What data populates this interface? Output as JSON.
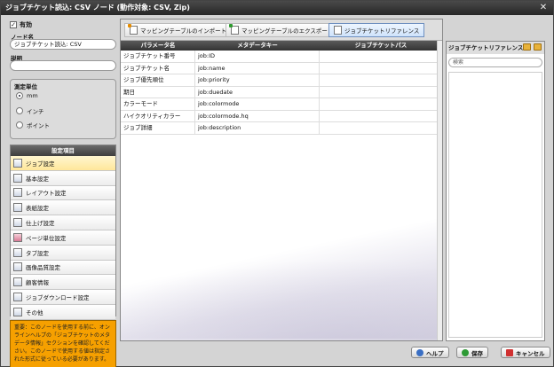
{
  "window": {
    "title": "ジョブチケット読込: CSV ノード (動作対象: CSV, Zip)",
    "close": "✕"
  },
  "left": {
    "enabled_label": "有効",
    "node_name_label": "ノード名",
    "node_name_value": "ジョブチケット読込: CSV",
    "description_label": "説明",
    "description_value": "",
    "unit": {
      "legend": "測定単位",
      "options": [
        "mm",
        "インチ",
        "ポイント"
      ],
      "selected": "mm"
    },
    "settings": {
      "header": "設定項目",
      "items": [
        "ジョブ設定",
        "基本設定",
        "レイアウト設定",
        "表紙設定",
        "仕上げ設定",
        "ページ単位設定",
        "タブ設定",
        "画像品質設定",
        "顧客情報",
        "ジョブダウンロード設定",
        "その他"
      ]
    },
    "note": "重要：このノードを使用する前に、オンラインヘルプの「ジョブチケットのメタデータ情報」セクションを確認してください。このノードで使用する値は指定された形式に従っている必要があります。"
  },
  "toolbar": {
    "import_label": "マッピングテーブルのインポート",
    "export_label": "マッピングテーブルのエクスポート",
    "reference_label": "ジョブチケットリファレンス"
  },
  "grid": {
    "headers": [
      "パラメータ名",
      "メタデータキー",
      "ジョブチケットパス"
    ],
    "rows": [
      [
        "ジョブチケット番号",
        "job:ID",
        ""
      ],
      [
        "ジョブチケット名",
        "job:name",
        ""
      ],
      [
        "ジョブ優先順位",
        "job:priority",
        ""
      ],
      [
        "期日",
        "job:duedate",
        ""
      ],
      [
        "カラーモード",
        "job:colormode",
        ""
      ],
      [
        "ハイクオリティカラー",
        "job:colormode.hq",
        ""
      ],
      [
        "ジョブ詳細",
        "job:description",
        ""
      ]
    ]
  },
  "reference": {
    "title": "ジョブチケットリファレンス",
    "search_placeholder": "検索"
  },
  "footer": {
    "help": "ヘルプ",
    "save": "保存",
    "cancel": "キャンセル"
  },
  "colors": {
    "note_bg": "#f6a000",
    "active_item": "#ffe79a",
    "header_dark": "#333333"
  }
}
